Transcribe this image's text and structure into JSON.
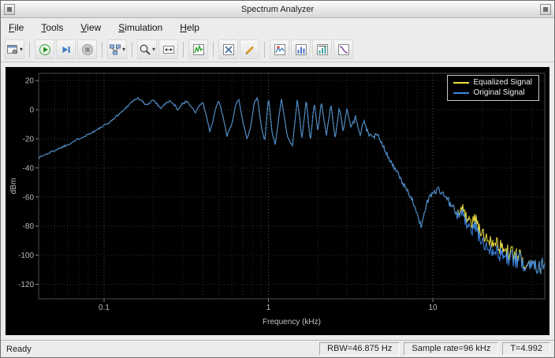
{
  "window": {
    "title": "Spectrum Analyzer"
  },
  "menu": {
    "items": [
      {
        "label": "File"
      },
      {
        "label": "Tools"
      },
      {
        "label": "View"
      },
      {
        "label": "Simulation"
      },
      {
        "label": "Help"
      }
    ]
  },
  "toolbar": {
    "buttons": [
      {
        "name": "scope-settings",
        "icon": "settings",
        "dropdown": true
      },
      {
        "type": "separator"
      },
      {
        "name": "run",
        "icon": "run"
      },
      {
        "name": "step-forward",
        "icon": "step"
      },
      {
        "name": "stop",
        "icon": "stop"
      },
      {
        "type": "separator"
      },
      {
        "name": "playback-options",
        "icon": "playback",
        "dropdown": true
      },
      {
        "type": "separator"
      },
      {
        "name": "zoom",
        "icon": "zoom",
        "dropdown": true
      },
      {
        "name": "span-full-view",
        "icon": "span"
      },
      {
        "type": "separator"
      },
      {
        "name": "spectrum-view",
        "icon": "spectrum"
      },
      {
        "type": "separator"
      },
      {
        "name": "cursor-measurements",
        "icon": "cursors"
      },
      {
        "name": "signal-statistics",
        "icon": "stats"
      },
      {
        "type": "separator"
      },
      {
        "name": "peak-finder",
        "icon": "peaks"
      },
      {
        "name": "distortion-measurements",
        "icon": "distortion"
      },
      {
        "name": "channel-measurements",
        "icon": "channel"
      },
      {
        "name": "ccdf-measurements",
        "icon": "ccdf"
      }
    ]
  },
  "chart_data": {
    "type": "line",
    "title": "",
    "xlabel": "Frequency (kHz)",
    "ylabel": "dBm",
    "x_scale": "log",
    "xlim": [
      0.04,
      48
    ],
    "ylim": [
      -130,
      25
    ],
    "xticks": [
      0.1,
      1,
      10
    ],
    "yticks": [
      20,
      0,
      -20,
      -40,
      -60,
      -80,
      -100,
      -120
    ],
    "grid": true,
    "legend_position": "top-right",
    "background": "#000000",
    "freq_khz": [
      0.04,
      0.05,
      0.06,
      0.07,
      0.08,
      0.09,
      0.1,
      0.11,
      0.12,
      0.13,
      0.14,
      0.15,
      0.16,
      0.17,
      0.18,
      0.19,
      0.2,
      0.21,
      0.22,
      0.23,
      0.25,
      0.27,
      0.28,
      0.3,
      0.32,
      0.34,
      0.36,
      0.38,
      0.4,
      0.42,
      0.44,
      0.46,
      0.48,
      0.5,
      0.53,
      0.56,
      0.6,
      0.63,
      0.66,
      0.7,
      0.74,
      0.78,
      0.82,
      0.86,
      0.9,
      0.95,
      1,
      1.05,
      1.1,
      1.2,
      1.3,
      1.4,
      1.5,
      1.6,
      1.7,
      1.8,
      1.9,
      2,
      2.1,
      2.25,
      2.4,
      2.55,
      2.7,
      2.85,
      3,
      3.2,
      3.4,
      3.6,
      3.8,
      4,
      4.3,
      4.6,
      5,
      5.5,
      6,
      6.5,
      7,
      7.5,
      8,
      8.5,
      9,
      9.5,
      10,
      11,
      12,
      13,
      14,
      15,
      16,
      17,
      18,
      19,
      20,
      22,
      24,
      26,
      28,
      30,
      33,
      36,
      40,
      44,
      48
    ],
    "series": [
      {
        "name": "Equalized Signal",
        "color": "#f0e040",
        "values": [
          -33,
          -28,
          -24,
          -20,
          -17,
          -14,
          -11,
          -8,
          -4,
          -1,
          3,
          6,
          8,
          6,
          3,
          5,
          7,
          4,
          1,
          3,
          6,
          3,
          0,
          4,
          6,
          2,
          -2,
          3,
          5,
          -5,
          -15,
          -8,
          2,
          6,
          -5,
          -18,
          -10,
          3,
          7,
          -8,
          -20,
          -12,
          5,
          8,
          -10,
          -22,
          9,
          -15,
          -24,
          8,
          -18,
          -25,
          8,
          -20,
          7,
          -22,
          5,
          -15,
          6,
          -18,
          4,
          -20,
          2,
          -15,
          0,
          -12,
          -5,
          -18,
          -8,
          -15,
          -20,
          -16,
          -25,
          -35,
          -42,
          -50,
          -55,
          -62,
          -72,
          -80,
          -68,
          -60,
          -57,
          -55,
          -60,
          -66,
          -73,
          -67,
          -74,
          -79,
          -74,
          -81,
          -86,
          -88,
          -91,
          -95,
          -97,
          -99,
          -102,
          -104,
          -106,
          -106,
          -107
        ]
      },
      {
        "name": "Original Signal",
        "color": "#3b84de",
        "values": [
          -33,
          -28,
          -24,
          -20,
          -17,
          -14,
          -11,
          -8,
          -4,
          -1,
          3,
          6,
          8,
          6,
          3,
          5,
          7,
          4,
          1,
          3,
          6,
          3,
          0,
          4,
          6,
          2,
          -2,
          3,
          5,
          -5,
          -15,
          -8,
          2,
          6,
          -5,
          -18,
          -10,
          3,
          7,
          -8,
          -20,
          -12,
          5,
          8,
          -10,
          -22,
          9,
          -15,
          -24,
          8,
          -18,
          -25,
          8,
          -20,
          7,
          -22,
          5,
          -15,
          6,
          -18,
          4,
          -20,
          2,
          -15,
          0,
          -12,
          -5,
          -18,
          -8,
          -15,
          -20,
          -16,
          -25,
          -35,
          -42,
          -50,
          -55,
          -62,
          -72,
          -80,
          -68,
          -60,
          -57,
          -55,
          -60,
          -66,
          -73,
          -70,
          -78,
          -84,
          -79,
          -86,
          -92,
          -94,
          -97,
          -100,
          -101,
          -102,
          -104,
          -105,
          -106,
          -106,
          -107
        ]
      }
    ]
  },
  "status": {
    "ready": "Ready",
    "rbw": "RBW=46.875 Hz",
    "sample_rate": "Sample rate=96 kHz",
    "time": "T=4.992"
  }
}
